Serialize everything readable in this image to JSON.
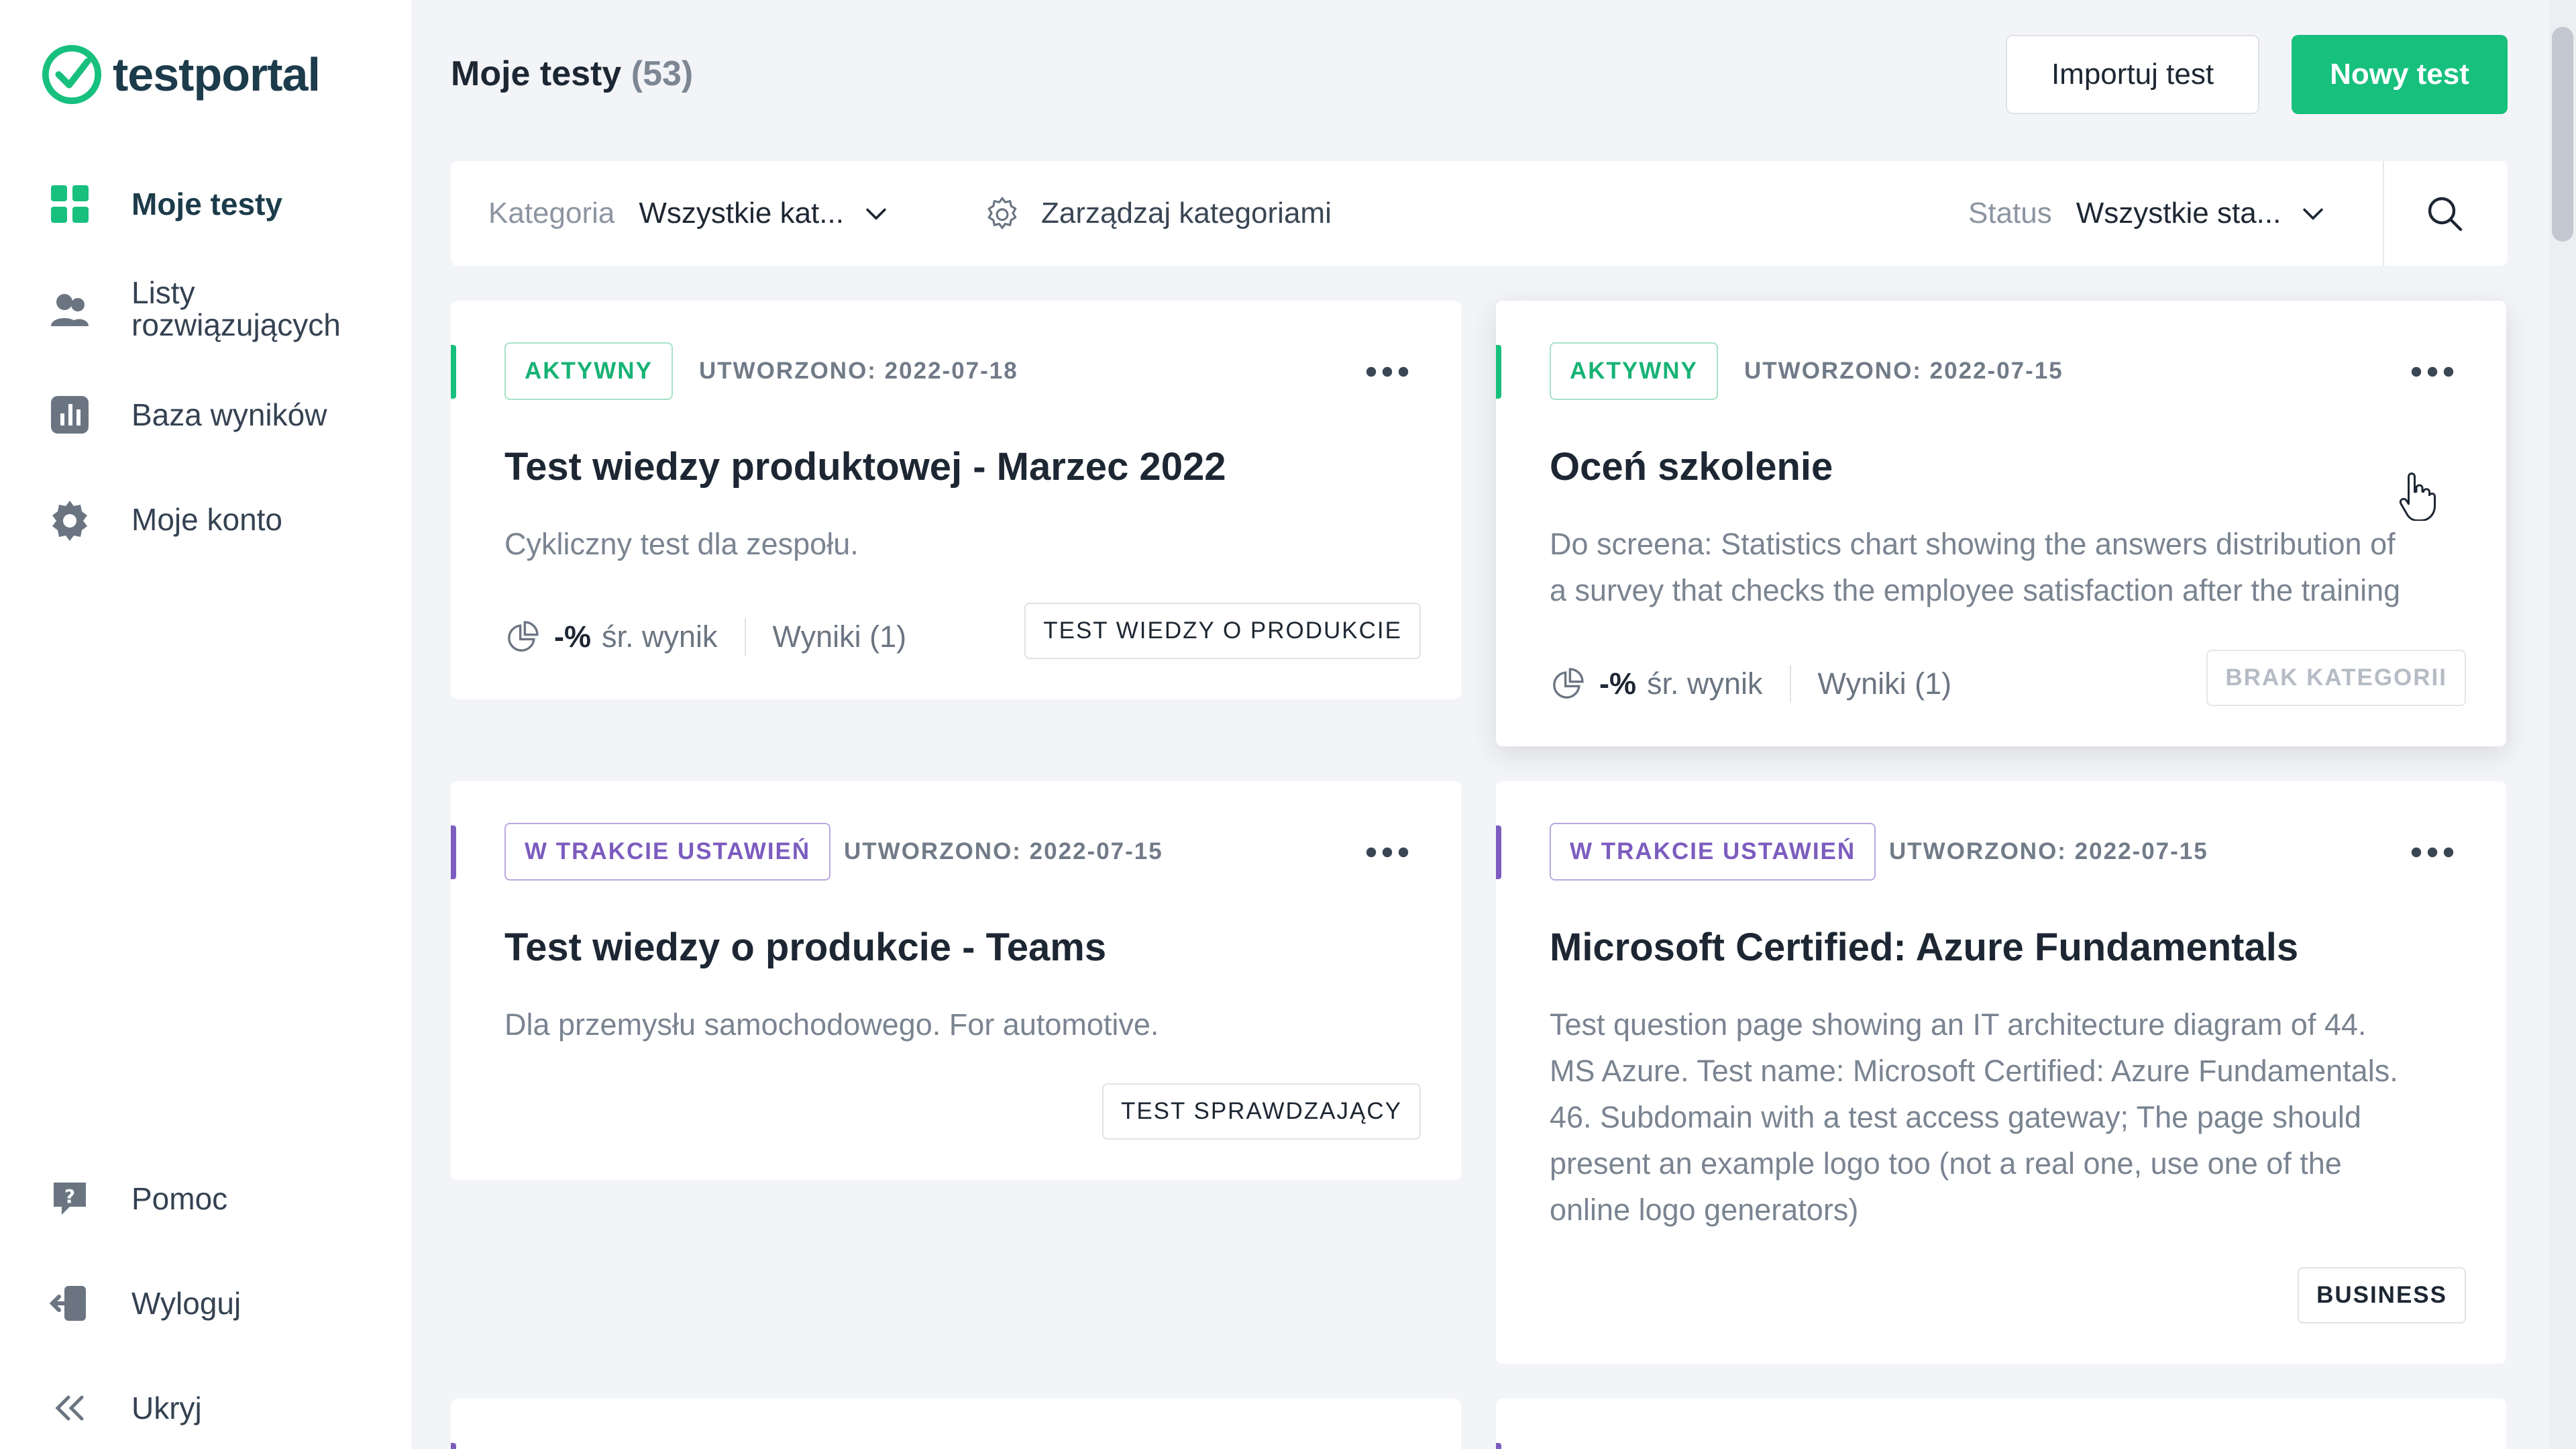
{
  "brand": {
    "name": "testportal",
    "accent": "#17c07d",
    "dark": "#1c3b4b"
  },
  "sidebar": {
    "items": [
      {
        "label": "Moje testy",
        "icon": "grid-icon",
        "active": true
      },
      {
        "label": "Listy rozwiązujących",
        "icon": "users-icon"
      },
      {
        "label": "Baza wyników",
        "icon": "chart-icon"
      },
      {
        "label": "Moje konto",
        "icon": "gear-icon"
      }
    ],
    "bottom": [
      {
        "label": "Pomoc",
        "icon": "help-icon"
      },
      {
        "label": "Wyloguj",
        "icon": "logout-icon"
      },
      {
        "label": "Ukryj",
        "icon": "collapse-icon"
      }
    ]
  },
  "header": {
    "title": "Moje testy",
    "count": "(53)",
    "import_label": "Importuj test",
    "new_label": "Nowy test"
  },
  "filters": {
    "category_label": "Kategoria",
    "category_value": "Wszystkie kat...",
    "manage_label": "Zarządzaj kategoriami",
    "status_label": "Status",
    "status_value": "Wszystkie sta..."
  },
  "cards": [
    {
      "status": "AKTYWNY",
      "created": "UTWORZONO: 2022-07-18",
      "title": "Test wiedzy produktowej - Marzec 2022",
      "description": "Cykliczny test dla zespołu.",
      "avg_value": "-%",
      "avg_label": "śr. wynik",
      "results": "Wyniki (1)",
      "tag": "TEST WIEDZY O PRODUKCIE"
    },
    {
      "status": "AKTYWNY",
      "created": "UTWORZONO: 2022-07-15",
      "title": "Oceń szkolenie",
      "description_lines": [
        "Do screena: Statistics chart showing the answers distribution of",
        "a survey that checks the employee satisfaction after the training"
      ],
      "avg_value": "-%",
      "avg_label": "śr. wynik",
      "results": "Wyniki (1)",
      "tag": "BRAK KATEGORII"
    },
    {
      "status": "W TRAKCIE USTAWIEŃ",
      "created": "UTWORZONO: 2022-07-15",
      "title": "Test wiedzy o produkcie - Teams",
      "description": "Dla przemysłu samochodowego. For automotive.",
      "tag": "TEST SPRAWDZAJĄCY"
    },
    {
      "status": "W TRAKCIE USTAWIEŃ",
      "created": "UTWORZONO: 2022-07-15",
      "title": "Microsoft Certified: Azure Fundamentals",
      "description_lines": [
        "Test question page showing an IT architecture diagram of 44.",
        "MS Azure. Test name: Microsoft Certified: Azure Fundamentals.",
        "46. Subdomain with a test access gateway; The page should",
        "present an example logo too (not a real one, use one of the",
        "online logo generators)"
      ],
      "tag": "BUSINESS"
    }
  ]
}
